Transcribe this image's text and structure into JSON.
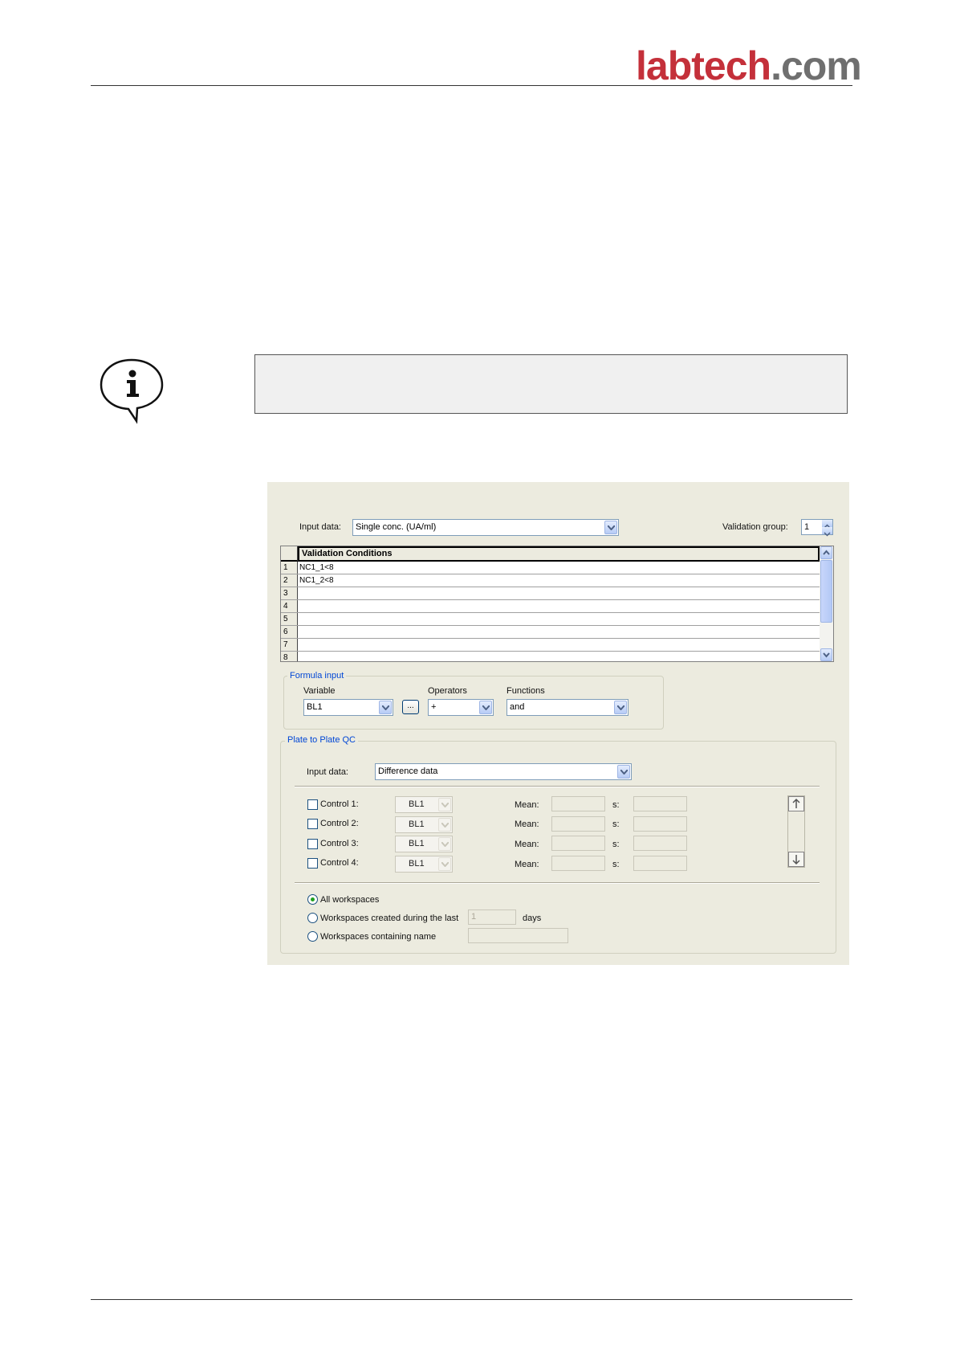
{
  "header": {
    "logo_brand": "labtech",
    "logo_tld": ".com"
  },
  "dialog": {
    "input_data_label": "Input data:",
    "input_data_value": "Single conc. (UA/ml)",
    "validation_group_label": "Validation group:",
    "validation_group_value": "1",
    "grid_header": "Validation Conditions",
    "rows": [
      {
        "num": "1",
        "text": "NC1_1<8"
      },
      {
        "num": "2",
        "text": "NC1_2<8"
      },
      {
        "num": "3",
        "text": ""
      },
      {
        "num": "4",
        "text": ""
      },
      {
        "num": "5",
        "text": ""
      },
      {
        "num": "6",
        "text": ""
      },
      {
        "num": "7",
        "text": ""
      },
      {
        "num": "8",
        "text": ""
      }
    ],
    "formula": {
      "title": "Formula input",
      "variable_label": "Variable",
      "variable_value": "BL1",
      "dots_label": "...",
      "operators_label": "Operators",
      "operators_value": "+",
      "functions_label": "Functions",
      "functions_value": "and"
    },
    "qc": {
      "title": "Plate to Plate QC",
      "input_data_label": "Input data:",
      "input_data_value": "Difference data",
      "controls": [
        {
          "label": "Control 1:",
          "value": "BL1",
          "mean_label": "Mean:",
          "s_label": "s:"
        },
        {
          "label": "Control 2:",
          "value": "BL1",
          "mean_label": "Mean:",
          "s_label": "s:"
        },
        {
          "label": "Control 3:",
          "value": "BL1",
          "mean_label": "Mean:",
          "s_label": "s:"
        },
        {
          "label": "Control 4:",
          "value": "BL1",
          "mean_label": "Mean:",
          "s_label": "s:"
        }
      ],
      "radio_all": "All workspaces",
      "radio_days": "Workspaces created during the last",
      "days_value": "1",
      "days_unit": "days",
      "radio_name": "Workspaces containing name"
    }
  }
}
